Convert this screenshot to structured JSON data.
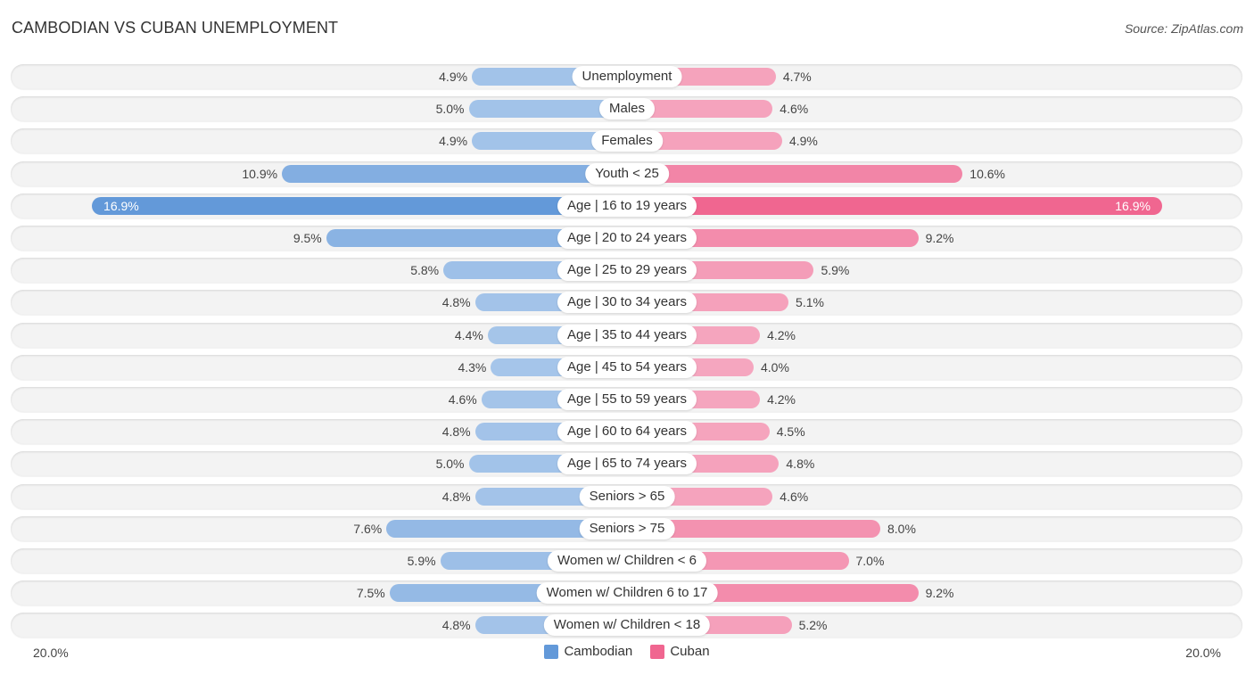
{
  "header": {
    "title": "CAMBODIAN VS CUBAN UNEMPLOYMENT",
    "source": "Source: ZipAtlas.com"
  },
  "colors": {
    "cambodian": "#a7c6ea",
    "cambodian_strong": "#6399d9",
    "cuban": "#f5a6bf",
    "cuban_strong": "#f06690"
  },
  "chart_data": {
    "type": "bar",
    "orientation": "horizontal-diverging",
    "title": "CAMBODIAN VS CUBAN UNEMPLOYMENT",
    "xlim": [
      -20,
      20
    ],
    "axis_labels": {
      "left": "20.0%",
      "right": "20.0%"
    },
    "legend": {
      "position": "bottom-center",
      "entries": [
        "Cambodian",
        "Cuban"
      ]
    },
    "categories": [
      "Unemployment",
      "Males",
      "Females",
      "Youth < 25",
      "Age | 16 to 19 years",
      "Age | 20 to 24 years",
      "Age | 25 to 29 years",
      "Age | 30 to 34 years",
      "Age | 35 to 44 years",
      "Age | 45 to 54 years",
      "Age | 55 to 59 years",
      "Age | 60 to 64 years",
      "Age | 65 to 74 years",
      "Seniors > 65",
      "Seniors > 75",
      "Women w/ Children < 6",
      "Women w/ Children 6 to 17",
      "Women w/ Children < 18"
    ],
    "series": [
      {
        "name": "Cambodian",
        "side": "left",
        "values": [
          4.9,
          5.0,
          4.9,
          10.9,
          16.9,
          9.5,
          5.8,
          4.8,
          4.4,
          4.3,
          4.6,
          4.8,
          5.0,
          4.8,
          7.6,
          5.9,
          7.5,
          4.8
        ],
        "labels": [
          "4.9%",
          "5.0%",
          "4.9%",
          "10.9%",
          "16.9%",
          "9.5%",
          "5.8%",
          "4.8%",
          "4.4%",
          "4.3%",
          "4.6%",
          "4.8%",
          "5.0%",
          "4.8%",
          "7.6%",
          "5.9%",
          "7.5%",
          "4.8%"
        ]
      },
      {
        "name": "Cuban",
        "side": "right",
        "values": [
          4.7,
          4.6,
          4.9,
          10.6,
          16.9,
          9.2,
          5.9,
          5.1,
          4.2,
          4.0,
          4.2,
          4.5,
          4.8,
          4.6,
          8.0,
          7.0,
          9.2,
          5.2
        ],
        "labels": [
          "4.7%",
          "4.6%",
          "4.9%",
          "10.6%",
          "16.9%",
          "9.2%",
          "5.9%",
          "5.1%",
          "4.2%",
          "4.0%",
          "4.2%",
          "4.5%",
          "4.8%",
          "4.6%",
          "8.0%",
          "7.0%",
          "9.2%",
          "5.2%"
        ]
      }
    ]
  }
}
